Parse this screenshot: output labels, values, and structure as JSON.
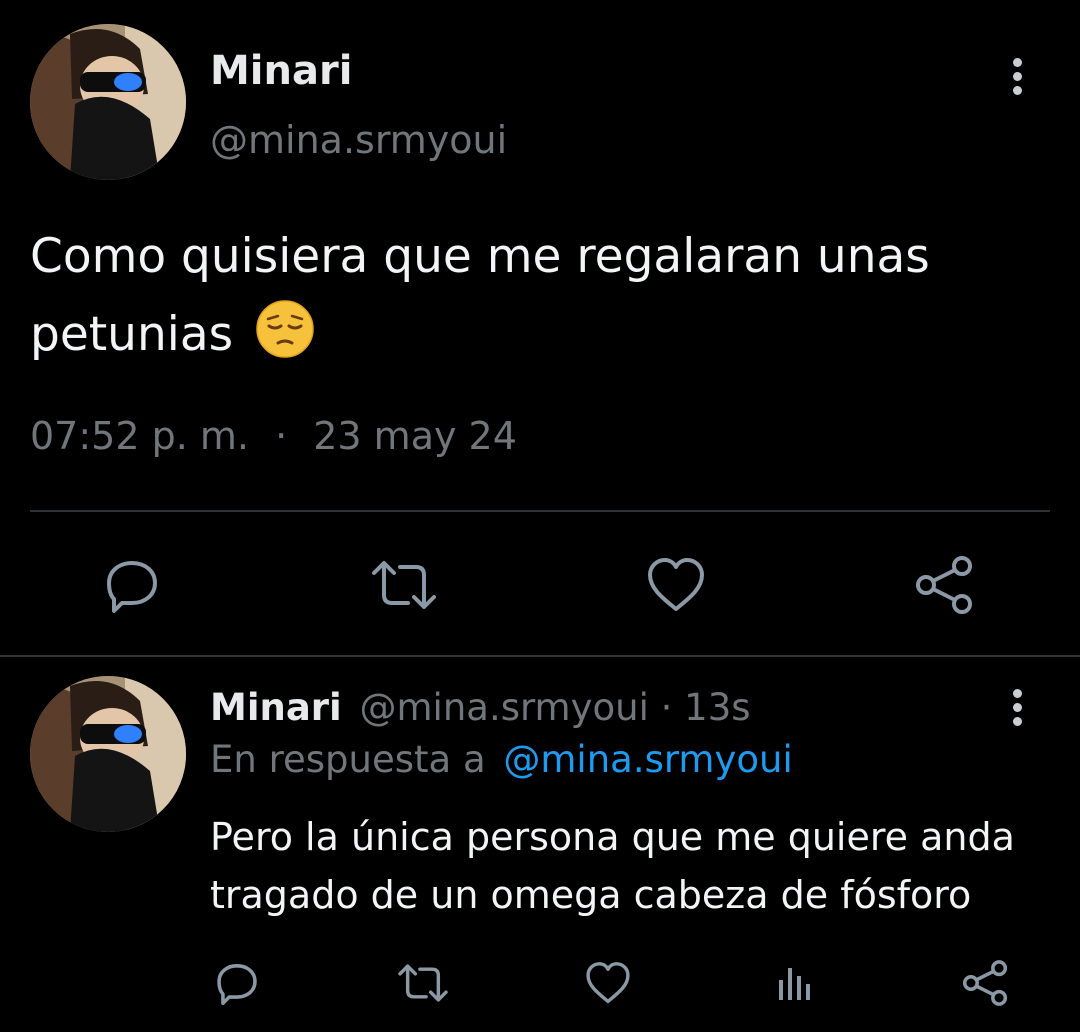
{
  "main_tweet": {
    "author_name": "Minari",
    "handle": "@mina.srmyoui",
    "text_line1": "Como quisiera que me regalaran unas",
    "text_line2": "petunias",
    "emoji": "😔",
    "time": "07:52 p. m.",
    "separator": "·",
    "date": "23 may 24",
    "actions": [
      "reply-icon",
      "retweet-icon",
      "like-icon",
      "share-icon"
    ]
  },
  "reply_tweet": {
    "author_name": "Minari",
    "handle": "@mina.srmyoui",
    "age": "· 13s",
    "reply_prefix": "En respuesta a",
    "reply_to": "@mina.srmyoui",
    "text_line1": "Pero la única persona que me quiere anda",
    "text_line2": "tragado de un omega cabeza de fósforo",
    "actions": [
      "reply-icon",
      "retweet-icon",
      "like-icon",
      "analytics-icon",
      "share-icon"
    ]
  },
  "colors": {
    "background": "#000000",
    "text": "#e7e9ea",
    "muted": "#71767b",
    "link": "#1d9bf0",
    "divider": "#2f3336",
    "icon": "#8b98a5"
  }
}
